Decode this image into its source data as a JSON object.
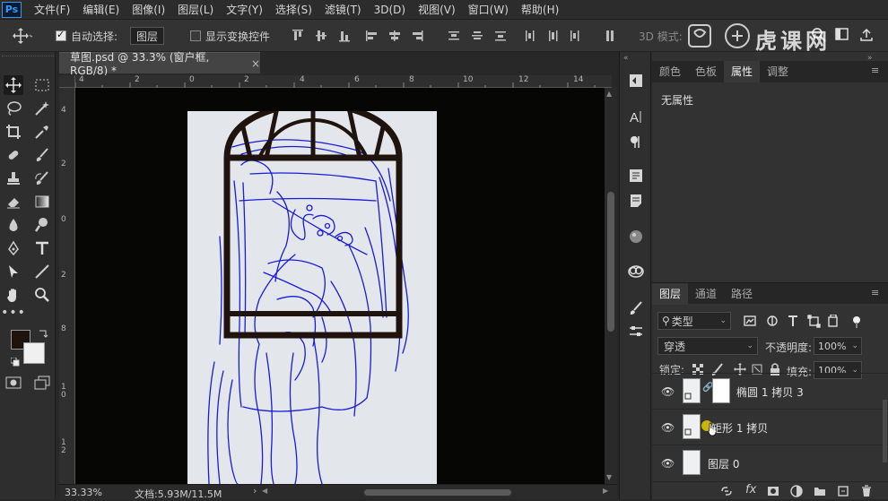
{
  "menu": {
    "logo": "Ps",
    "items": [
      "文件(F)",
      "编辑(E)",
      "图像(I)",
      "图层(L)",
      "文字(Y)",
      "选择(S)",
      "滤镜(T)",
      "3D(D)",
      "视图(V)",
      "窗口(W)",
      "帮助(H)"
    ]
  },
  "options": {
    "auto_select_label": "自动选择:",
    "auto_select_value": "图层",
    "show_transform_label": "显示变换控件",
    "mode_3d_label": "3D 模式:"
  },
  "document": {
    "tab_title": "草图.psd @ 33.3% (窗户框, RGB/8) *",
    "close_glyph": "×",
    "ruler_top_labels": [
      "4",
      "2",
      "0",
      "2",
      "4",
      "6",
      "8",
      "10",
      "12",
      "14"
    ],
    "ruler_left_labels": [
      "4",
      "2",
      "0",
      "2",
      "4",
      "6",
      "8",
      "1 0",
      "1 2"
    ]
  },
  "status": {
    "zoom": "33.33%",
    "doc_size": "文档:5.93M/11.5M",
    "arrow": "›"
  },
  "properties_panel": {
    "tabs": [
      "颜色",
      "色板",
      "属性",
      "调整"
    ],
    "active_tab": "属性",
    "content": "无属性"
  },
  "layers_panel": {
    "tabs": [
      "图层",
      "通道",
      "路径"
    ],
    "active_tab": "图层",
    "filter_kind": "类型",
    "blend_mode": "穿透",
    "opacity_label": "不透明度:",
    "opacity_value": "100%",
    "lock_label": "锁定:",
    "fill_label": "填充:",
    "fill_value": "100%",
    "layers": [
      {
        "name": "椭圆 1 拷贝 3"
      },
      {
        "name": "矩形 1 拷贝"
      },
      {
        "name": "图层 0"
      }
    ],
    "footer_icons": [
      "link-icon",
      "fx-icon",
      "mask-icon",
      "adjustment-icon",
      "folder-icon",
      "new-layer-icon",
      "trash-icon"
    ],
    "fx_label": "fx"
  },
  "colors": {
    "foreground": "#1f130e",
    "background": "#f0f0f0",
    "window_frame": "#1f130e",
    "sketch_lines": "#1a1ad8",
    "canvas_bg": "#e3e7eb"
  },
  "watermark": {
    "text": "虎课网"
  }
}
